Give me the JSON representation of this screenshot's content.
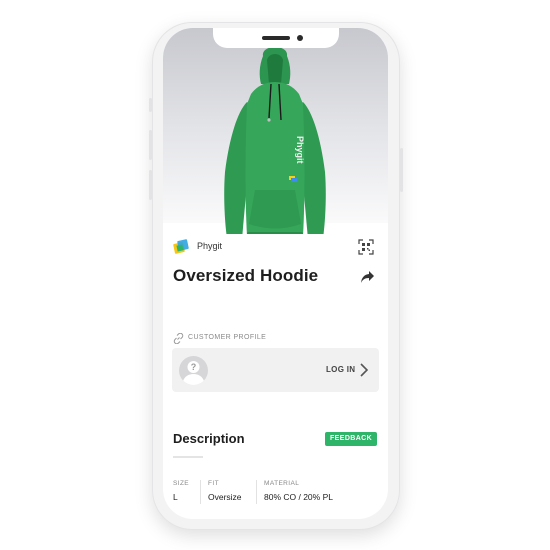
{
  "product": {
    "brand": "Phygit",
    "title": "Oversized Hoodie",
    "print_text": "Phygit"
  },
  "customer_profile": {
    "label": "CUSTOMER PROFILE",
    "login_label": "LOG IN"
  },
  "description": {
    "title": "Description",
    "feedback_label": "FEEDBACK"
  },
  "specs": [
    {
      "key": "SIZE",
      "value": "L"
    },
    {
      "key": "FIT",
      "value": "Oversize"
    },
    {
      "key": "MATERIAL",
      "value": "80% CO / 20% PL"
    }
  ],
  "icons": {
    "brand_logo": "phygit-logo",
    "qr": "qr-code-icon",
    "share": "share-icon",
    "link": "link-icon",
    "avatar": "question-avatar-icon",
    "chevron": "chevron-right-icon"
  },
  "colors": {
    "accent": "#2fb56a",
    "hoodie": "#2f9a4f"
  }
}
